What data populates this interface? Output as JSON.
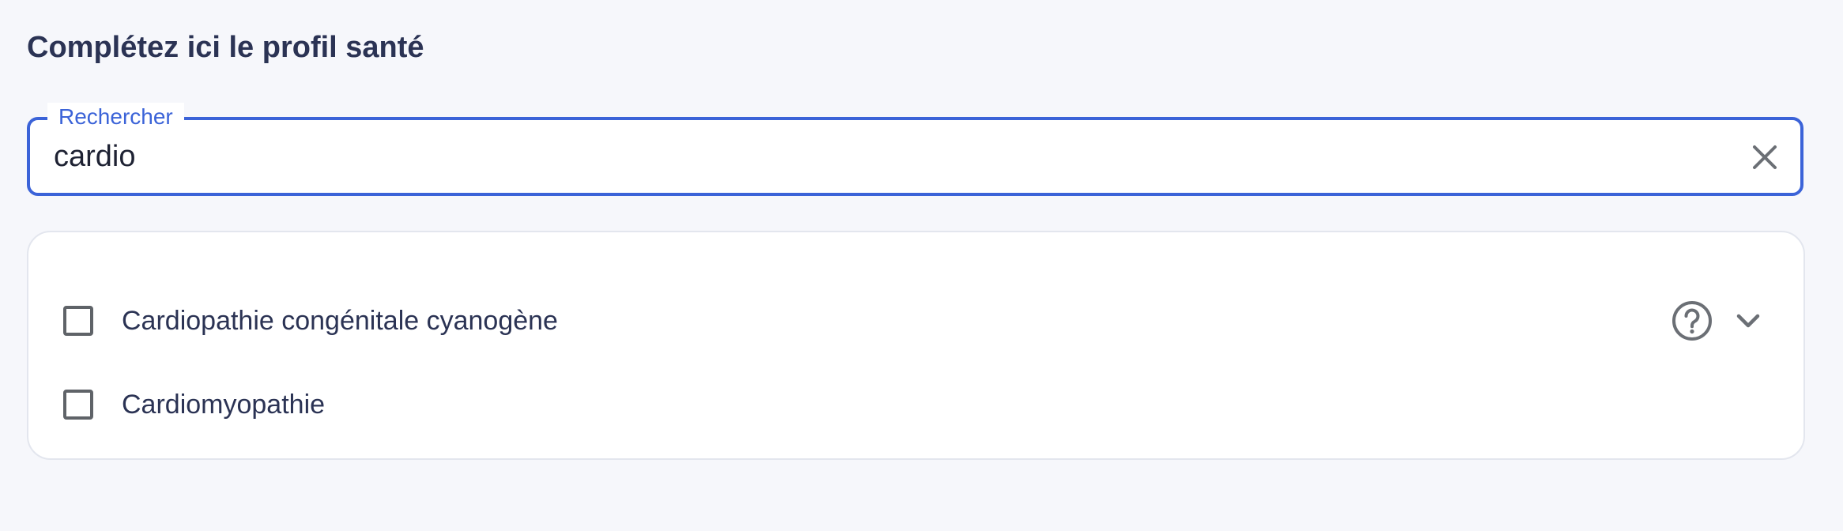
{
  "page": {
    "title": "Complétez ici le profil santé"
  },
  "search": {
    "label": "Rechercher",
    "value": "cardio",
    "clear_icon": "close-icon"
  },
  "results": [
    {
      "label": "Cardiopathie congénitale cyanogène",
      "checked": false,
      "has_help": true,
      "has_expand": true
    },
    {
      "label": "Cardiomyopathie",
      "checked": false,
      "has_help": false,
      "has_expand": false
    }
  ],
  "icons": {
    "help": "help-circle-icon",
    "expand": "chevron-down-icon"
  },
  "colors": {
    "accent": "#3b63d8",
    "text": "#2b3354",
    "background": "#f6f7fb",
    "icon_gray": "#6b6f75"
  }
}
